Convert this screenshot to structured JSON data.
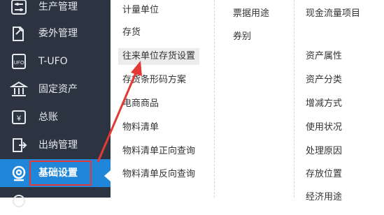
{
  "sidebar": {
    "items": [
      {
        "label": "生产管理",
        "icon": "sliders-icon"
      },
      {
        "label": "委外管理",
        "icon": "outsource-doc-icon"
      },
      {
        "label": "T-UFO",
        "icon": "ufo-report-icon"
      },
      {
        "label": "固定资产",
        "icon": "bank-building-icon"
      },
      {
        "label": "总账",
        "icon": "ledger-icon"
      },
      {
        "label": "出纳管理",
        "icon": "cashier-icon"
      },
      {
        "label": "基础设置",
        "icon": "settings-gear-icon",
        "active": true
      },
      {
        "label": "",
        "icon": "partial-icon"
      }
    ]
  },
  "menu": {
    "col1": [
      "计量单位",
      "存货",
      "往来单位存货设置",
      "存货条形码方案",
      "电商商品",
      "物料清单",
      "物料清单正向查询",
      "物料清单反向查询"
    ],
    "col2": [
      "票据用途",
      "券别"
    ],
    "col3": [
      "现金流量项目",
      "资产属性",
      "资产分类",
      "增减方式",
      "使用状况",
      "处理原因",
      "存放位置",
      "经济用途"
    ]
  },
  "colors": {
    "sidebar_bg": "#2b3440",
    "active_bg": "#1f86d9",
    "annotation_red": "#e53935"
  }
}
